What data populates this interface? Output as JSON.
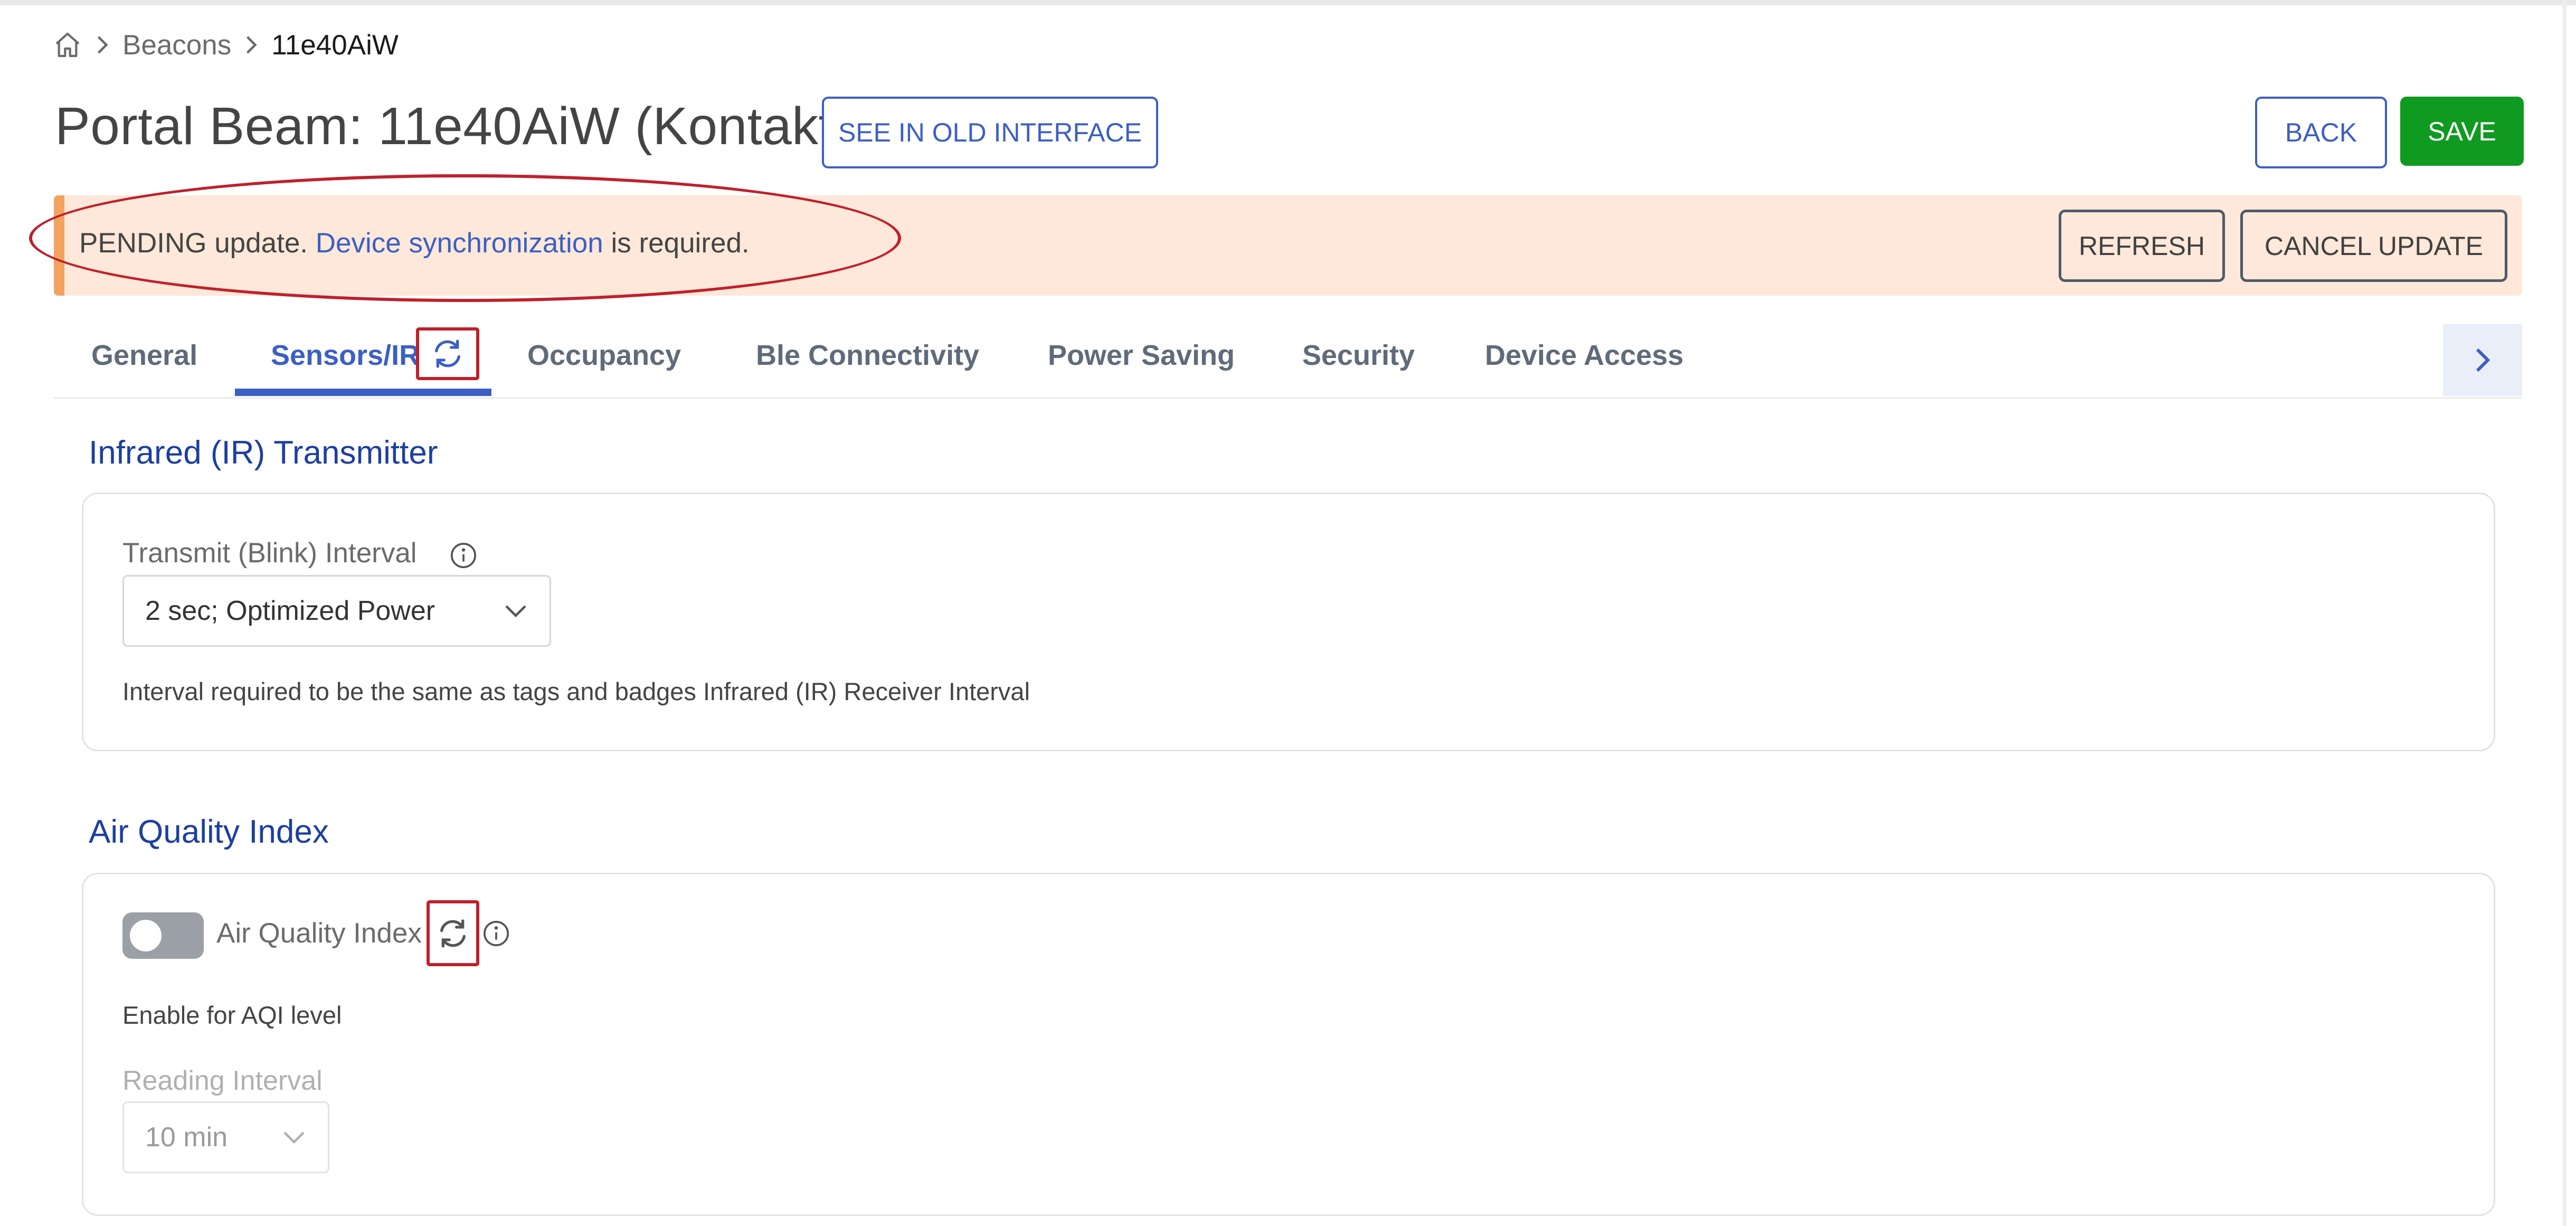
{
  "breadcrumb": {
    "home_icon": "home-icon",
    "items": [
      "Beacons",
      "11e40AiW"
    ]
  },
  "header": {
    "title": "Portal Beam: 11e40AiW (KontaktJ)",
    "old_interface_label": "SEE IN OLD INTERFACE",
    "back_label": "BACK",
    "save_label": "SAVE"
  },
  "banner": {
    "prefix": "PENDING update. ",
    "link": "Device synchronization",
    "suffix": " is required.",
    "refresh_label": "REFRESH",
    "cancel_label": "CANCEL UPDATE"
  },
  "tabs": {
    "items": [
      "General",
      "Sensors/IR",
      "Occupancy",
      "Ble Connectivity",
      "Power Saving",
      "Security",
      "Device Access"
    ],
    "active": "Sensors/IR"
  },
  "ir_section": {
    "title": "Infrared (IR) Transmitter",
    "interval_label": "Transmit (Blink) Interval",
    "interval_value": "2 sec; Optimized Power",
    "help_text": "Interval required to be the same as tags and badges Infrared (IR) Receiver Interval"
  },
  "aqi_section": {
    "title": "Air Quality Index",
    "toggle_label": "Air Quality Index",
    "toggle_on": false,
    "help_text": "Enable for AQI level",
    "reading_label": "Reading Interval",
    "reading_value": "10 min"
  },
  "colors": {
    "accent": "#3c5fc4",
    "save": "#0f9a20",
    "banner_bg": "#fde8d9",
    "banner_accent": "#f2a35f",
    "annotation_red": "#c0202b"
  }
}
